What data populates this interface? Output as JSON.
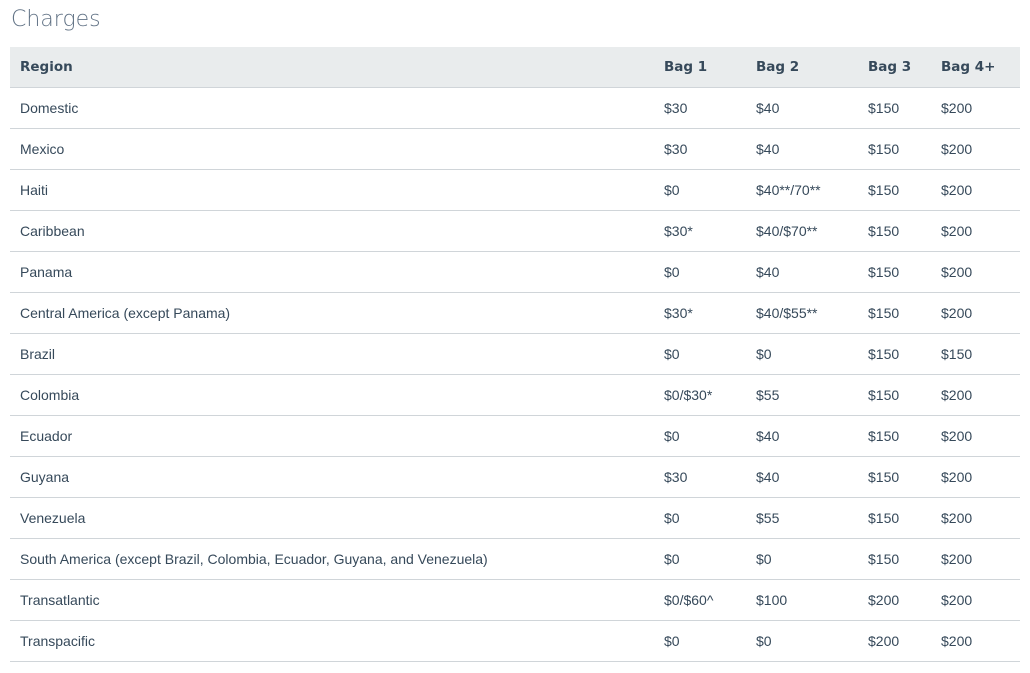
{
  "section": {
    "title": "Charges"
  },
  "table": {
    "headers": [
      "Region",
      "Bag 1",
      "Bag 2",
      "Bag 3",
      "Bag 4+"
    ],
    "rows": [
      [
        "Domestic",
        "$30",
        "$40",
        "$150",
        "$200"
      ],
      [
        "Mexico",
        "$30",
        "$40",
        "$150",
        "$200"
      ],
      [
        "Haiti",
        "$0",
        "$40**/70**",
        "$150",
        "$200"
      ],
      [
        "Caribbean",
        "$30*",
        "$40/$70**",
        "$150",
        "$200"
      ],
      [
        "Panama",
        "$0",
        "$40",
        "$150",
        "$200"
      ],
      [
        "Central America (except Panama)",
        "$30*",
        "$40/$55**",
        "$150",
        "$200"
      ],
      [
        "Brazil",
        "$0",
        "$0",
        "$150",
        "$150"
      ],
      [
        "Colombia",
        "$0/$30*",
        "$55",
        "$150",
        "$200"
      ],
      [
        "Ecuador",
        "$0",
        "$40",
        "$150",
        "$200"
      ],
      [
        "Guyana",
        "$30",
        "$40",
        "$150",
        "$200"
      ],
      [
        "Venezuela",
        "$0",
        "$55",
        "$150",
        "$200"
      ],
      [
        "South America (except Brazil, Colombia, Ecuador, Guyana, and Venezuela)",
        "$0",
        "$0",
        "$150",
        "$200"
      ],
      [
        "Transatlantic",
        "$0/$60^",
        "$100",
        "$200",
        "$200"
      ],
      [
        "Transpacific",
        "$0",
        "$0",
        "$200",
        "$200"
      ]
    ]
  }
}
